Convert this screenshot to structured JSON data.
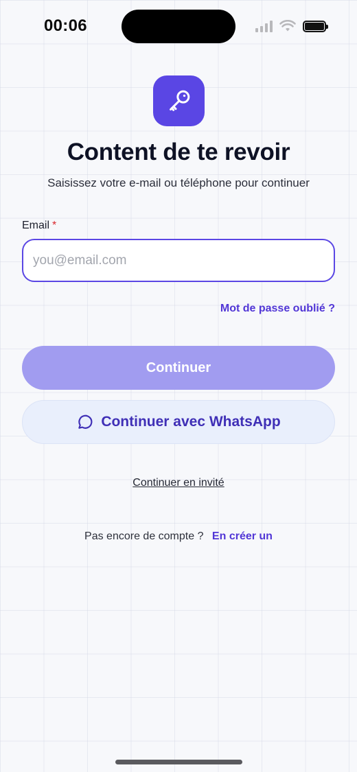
{
  "status_bar": {
    "time": "00:06"
  },
  "header": {
    "logo_icon": "key-icon",
    "title": "Content de te revoir",
    "subtitle": "Saisissez votre e-mail ou téléphone pour continuer"
  },
  "form": {
    "email_label": "Email",
    "required_marker": "*",
    "email_value": "",
    "email_placeholder": "you@email.com",
    "forgot_password": "Mot de passe oublié ?"
  },
  "actions": {
    "continue_label": "Continuer",
    "whatsapp_label": "Continuer avec WhatsApp",
    "whatsapp_icon": "chat-bubble-icon",
    "guest_label": "Continuer en invité"
  },
  "footer": {
    "no_account_text": "Pas encore de compte ?",
    "create_account_label": "En créer un"
  },
  "colors": {
    "accent": "#5a46e4",
    "continue_button": "#a19cf0",
    "whatsapp_button_bg": "#e9effc",
    "link": "#5136d6",
    "required": "#d9262c"
  }
}
